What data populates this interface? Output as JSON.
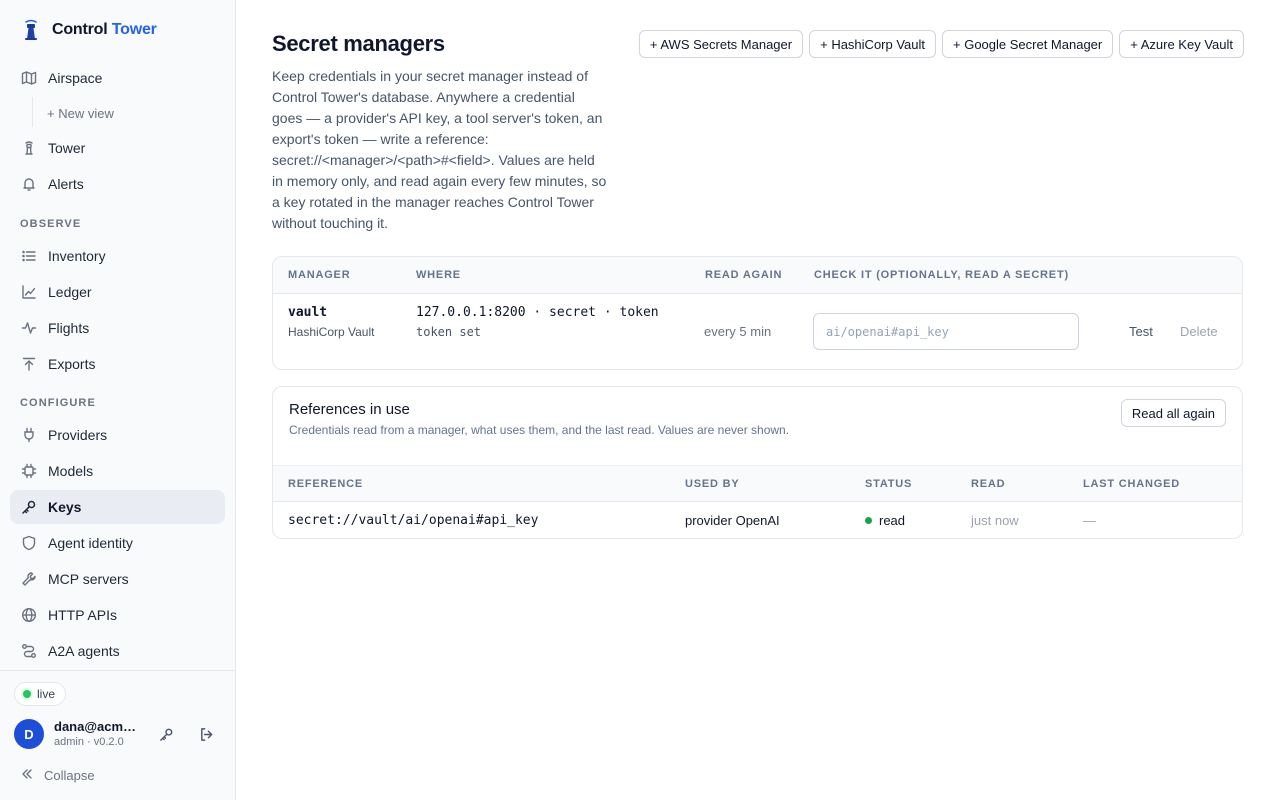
{
  "app": {
    "name_part1": "Control",
    "name_part2": "Tower",
    "logo_icon": "tower-icon"
  },
  "sidebar": {
    "items": [
      {
        "label": "Airspace",
        "icon": "map-icon"
      },
      {
        "label": "Tower",
        "icon": "tower-small-icon"
      },
      {
        "label": "Alerts",
        "icon": "bell-icon"
      },
      {
        "label": "Inventory",
        "icon": "list-icon"
      },
      {
        "label": "Ledger",
        "icon": "chart-line-icon"
      },
      {
        "label": "Flights",
        "icon": "activity-icon"
      },
      {
        "label": "Exports",
        "icon": "upload-icon"
      },
      {
        "label": "Providers",
        "icon": "plug-icon"
      },
      {
        "label": "Models",
        "icon": "chip-icon"
      },
      {
        "label": "Keys",
        "icon": "key-icon"
      },
      {
        "label": "Agent identity",
        "icon": "shield-icon"
      },
      {
        "label": "MCP servers",
        "icon": "wrench-icon"
      },
      {
        "label": "HTTP APIs",
        "icon": "globe-icon"
      },
      {
        "label": "A2A agents",
        "icon": "route-icon"
      }
    ],
    "new_view": "+ New view",
    "sections": {
      "observe": "OBSERVE",
      "configure": "CONFIGURE"
    },
    "footer": {
      "status": "live",
      "avatar_initial": "D",
      "user_name": "dana@acme.example",
      "user_role": "admin · v0.2.0",
      "collapse": "Collapse"
    }
  },
  "page": {
    "title": "Secret managers",
    "description": "Keep credentials in your secret manager instead of Control Tower's database. Anywhere a credential goes — a provider's API key, a tool server's token, an export's token — write a reference: secret://<manager>/<path>#<field>. Values are held in memory only, and read again every few minutes, so a key rotated in the manager reaches Control Tower without touching it.",
    "actions": [
      "+ AWS Secrets Manager",
      "+ HashiCorp Vault",
      "+ Google Secret Manager",
      "+ Azure Key Vault"
    ]
  },
  "managers": {
    "headers": {
      "manager": "MANAGER",
      "where": "WHERE",
      "read_again": "READ AGAIN",
      "check": "CHECK IT (OPTIONALLY, READ A SECRET)"
    },
    "rows": [
      {
        "name": "vault",
        "type": "HashiCorp Vault",
        "where": "127.0.0.1:8200 · secret · token",
        "where_sub": "token set",
        "read_again": "every 5 min",
        "check_placeholder": "ai/openai#api_key",
        "test": "Test",
        "delete": "Delete"
      }
    ]
  },
  "references": {
    "title": "References in use",
    "subtitle": "Credentials read from a manager, what uses them, and the last read. Values are never shown.",
    "read_all": "Read all again",
    "headers": {
      "reference": "REFERENCE",
      "used_by": "USED BY",
      "status": "STATUS",
      "read": "READ",
      "last_changed": "LAST CHANGED"
    },
    "rows": [
      {
        "reference": "secret://vault/ai/openai#api_key",
        "used_by": "provider OpenAI",
        "status": "read",
        "status_color": "#16a34a",
        "read": "just now",
        "last_changed": "—"
      }
    ]
  }
}
